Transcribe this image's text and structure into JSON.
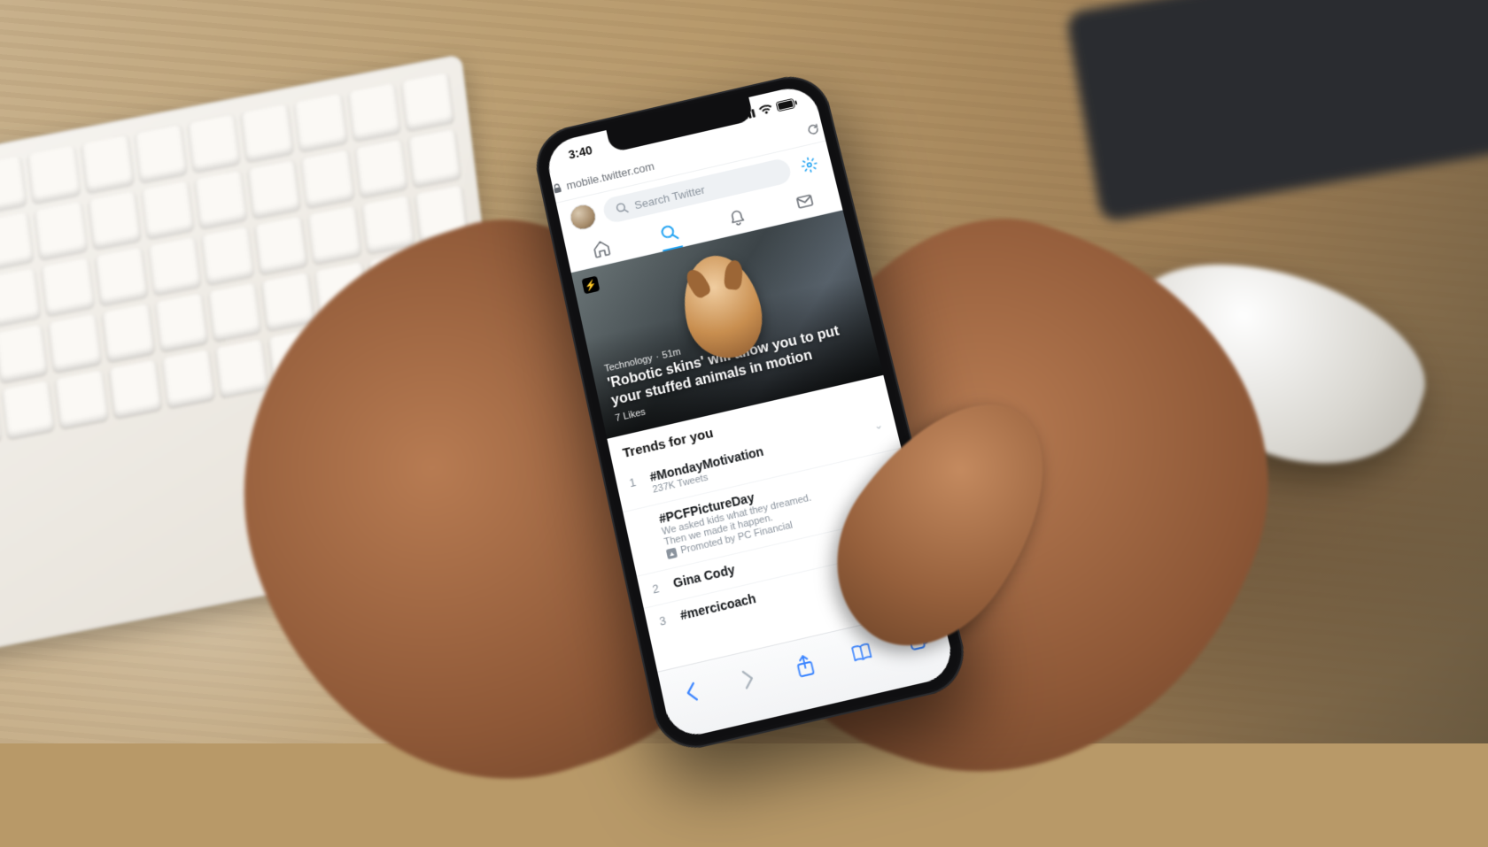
{
  "status_bar": {
    "time": "3:40"
  },
  "browser": {
    "url": "mobile.twitter.com"
  },
  "search": {
    "placeholder": "Search Twitter"
  },
  "hero": {
    "category": "Technology",
    "age": "51m",
    "title": "'Robotic skins' will allow you to put your stuffed animals in motion",
    "likes": "7 Likes"
  },
  "trends": {
    "section_title": "Trends for you",
    "items": [
      {
        "rank": "1",
        "name": "#MondayMotivation",
        "sub": "237K Tweets"
      },
      {
        "rank": "",
        "name": "#PCFPictureDay",
        "sub": "We asked kids what they dreamed.\nThen we made it happen.",
        "promoted_by": "Promoted by PC Financial"
      },
      {
        "rank": "2",
        "name": "Gina Cody",
        "sub": ""
      },
      {
        "rank": "3",
        "name": "#mercicoach",
        "sub": ""
      }
    ]
  },
  "colors": {
    "accent": "#1da1f2"
  }
}
